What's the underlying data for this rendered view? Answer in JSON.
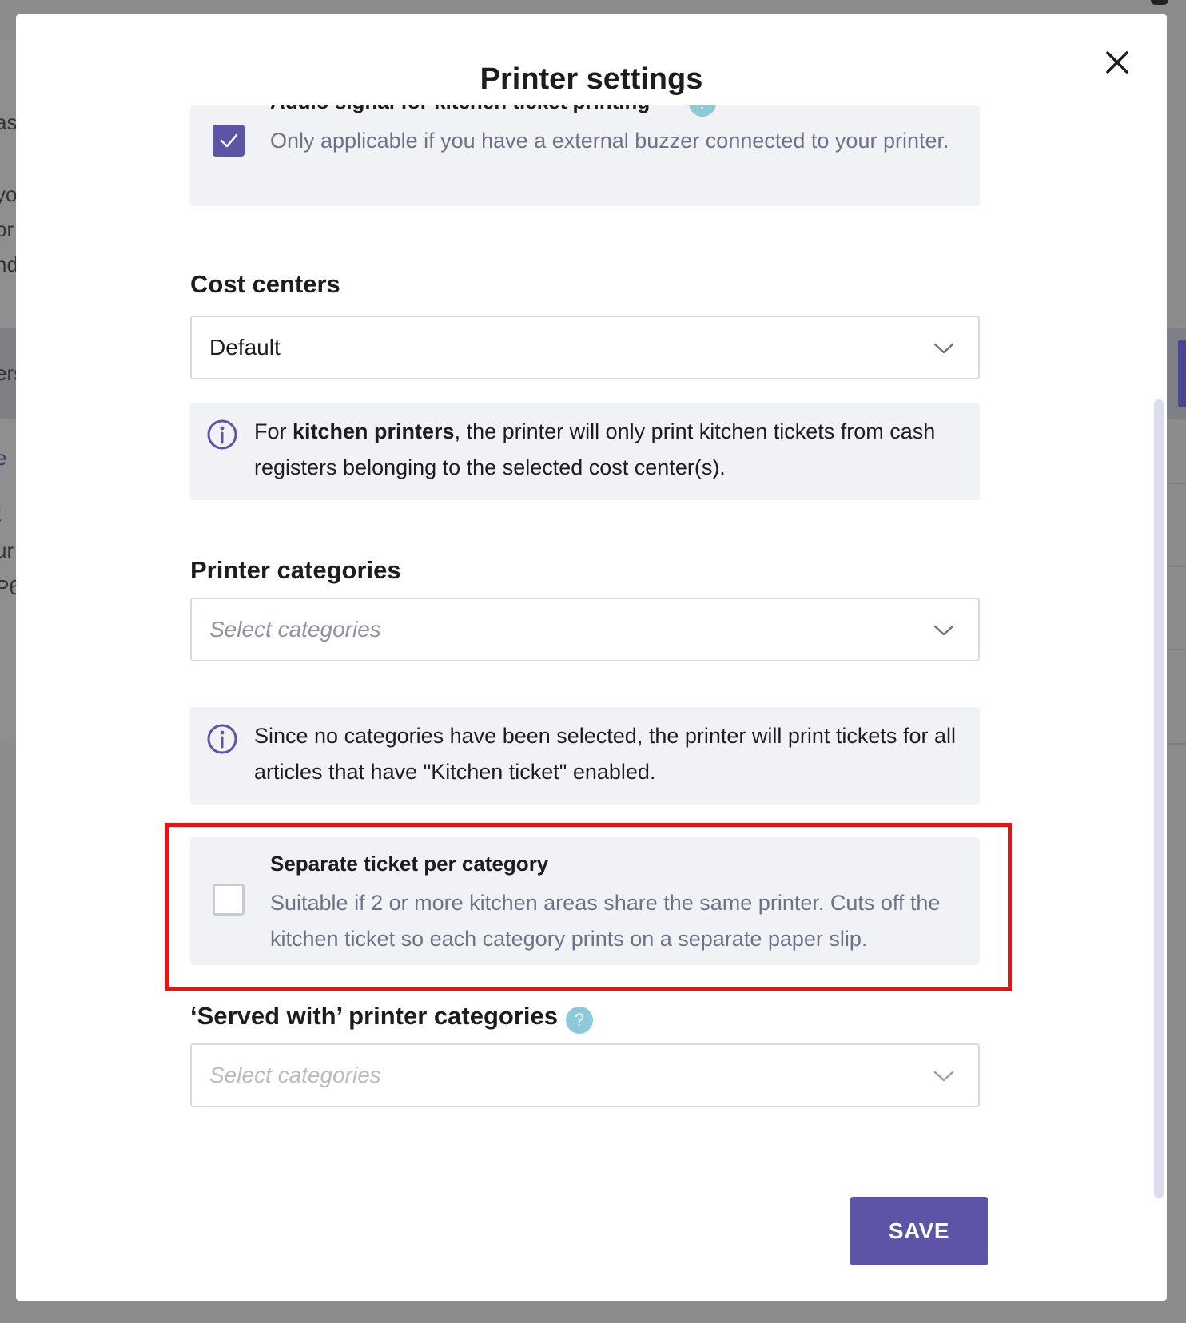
{
  "modal": {
    "title": "Printer settings",
    "save_label": "SAVE"
  },
  "audio_option": {
    "title": "Audio signal for kitchen ticket printing",
    "description": "Only applicable if you have a external buzzer connected to your printer.",
    "checked": true,
    "help_icon": "question-mark"
  },
  "cost_centers": {
    "label": "Cost centers",
    "value": "Default",
    "info_bold": "kitchen printers",
    "info_prefix": "For ",
    "info_suffix": ", the printer will only print kitchen tickets from cash registers belonging to the selected cost center(s)."
  },
  "printer_categories": {
    "label": "Printer categories",
    "placeholder": "Select categories",
    "info": "Since no categories have been selected, the printer will print tickets for all articles that have \"Kitchen ticket\" enabled."
  },
  "separate_ticket_option": {
    "title": "Separate ticket per category",
    "description": "Suitable if 2 or more kitchen areas share the same printer. Cuts off the kitchen ticket so each category prints on a separate paper slip.",
    "checked": false
  },
  "served_with": {
    "label": "‘Served with’ printer categories",
    "placeholder": "Select categories",
    "help_icon_text": "?"
  },
  "background_fragments": [
    "as",
    "yo",
    "or",
    "nd",
    "ers",
    "e",
    "t",
    "ur",
    "P6"
  ],
  "colors": {
    "accent": "#5d53a7",
    "highlight": "#ee1111",
    "help_icon": "#8cc9d9",
    "panel_bg": "#f1f2f6"
  }
}
